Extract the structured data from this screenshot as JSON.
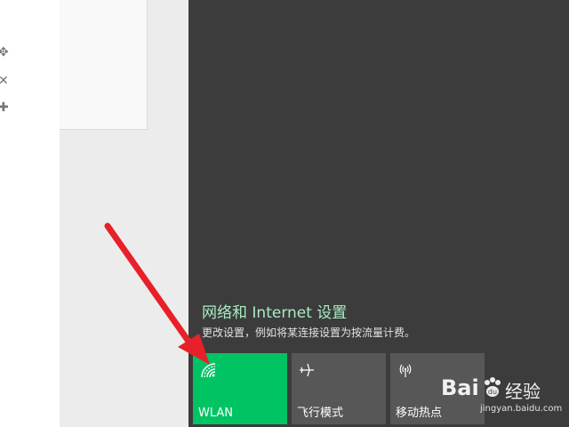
{
  "left_toolbar": {
    "icons": [
      "move-icon",
      "close-icon",
      "plus-icon"
    ]
  },
  "network": {
    "title": "网络和 Internet 设置",
    "description": "更改设置，例如将某连接设置为按流量计费。"
  },
  "quick_actions": [
    {
      "label": "WLAN",
      "icon": "wifi-icon",
      "active": true
    },
    {
      "label": "飞行模式",
      "icon": "airplane-icon",
      "active": false
    },
    {
      "label": "移动热点",
      "icon": "hotspot-icon",
      "active": false
    }
  ],
  "watermark": {
    "brand": "Bai",
    "paw": "du",
    "product": "经验",
    "url": "jingyan.baidu.com"
  },
  "colors": {
    "panel_bg": "#3c3c3c",
    "tile_active": "#00c464",
    "tile_inactive": "#575757",
    "link": "#a9ecc2",
    "arrow": "#e8202a"
  }
}
